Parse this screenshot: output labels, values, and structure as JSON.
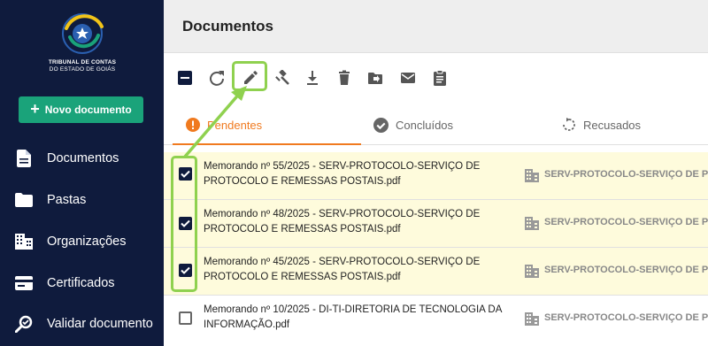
{
  "sidebar": {
    "logo": {
      "line1": "TRIBUNAL DE CONTAS",
      "line2": "DO ESTADO DE GOIÁS"
    },
    "new_document_label": "Novo documento",
    "items": [
      {
        "label": "Documentos",
        "icon": "document-icon"
      },
      {
        "label": "Pastas",
        "icon": "folder-icon"
      },
      {
        "label": "Organizações",
        "icon": "organization-icon"
      },
      {
        "label": "Certificados",
        "icon": "card-icon"
      },
      {
        "label": "Validar documento",
        "icon": "search-icon"
      }
    ]
  },
  "header": {
    "title": "Documentos"
  },
  "toolbar": {
    "actions": [
      "deselect-all",
      "refresh",
      "edit",
      "sign",
      "download",
      "delete",
      "move-to-folder",
      "email",
      "clipboard"
    ]
  },
  "tabs": [
    {
      "label": "Pendentes",
      "active": true
    },
    {
      "label": "Concluídos",
      "active": false
    },
    {
      "label": "Recusados",
      "active": false
    }
  ],
  "documents": [
    {
      "name_line1": "Memorando nº 55/2025 - SERV-PROTOCOLO-SERVIÇO DE",
      "name_line2": "PROTOCOLO E REMESSAS POSTAIS.pdf",
      "org": "SERV-PROTOCOLO-SERVIÇO DE PR",
      "checked": true
    },
    {
      "name_line1": "Memorando nº 48/2025 - SERV-PROTOCOLO-SERVIÇO DE",
      "name_line2": "PROTOCOLO E REMESSAS POSTAIS.pdf",
      "org": "SERV-PROTOCOLO-SERVIÇO DE PR",
      "checked": true
    },
    {
      "name_line1": "Memorando nº 45/2025 - SERV-PROTOCOLO-SERVIÇO DE",
      "name_line2": "PROTOCOLO E REMESSAS POSTAIS.pdf",
      "org": "SERV-PROTOCOLO-SERVIÇO DE PR",
      "checked": true
    },
    {
      "name_line1": "Memorando nº 10/2025 - DI-TI-DIRETORIA DE TECNOLOGIA DA",
      "name_line2": "INFORMAÇÃO.pdf",
      "org": "SERV-PROTOCOLO-SERVIÇO DE PR",
      "checked": false
    }
  ],
  "colors": {
    "sidebar": "#0f1b3d",
    "accent": "#f07a1f",
    "primary_button": "#1aa37a",
    "highlight": "#8fd14f",
    "selected_row": "#fefbdc"
  }
}
